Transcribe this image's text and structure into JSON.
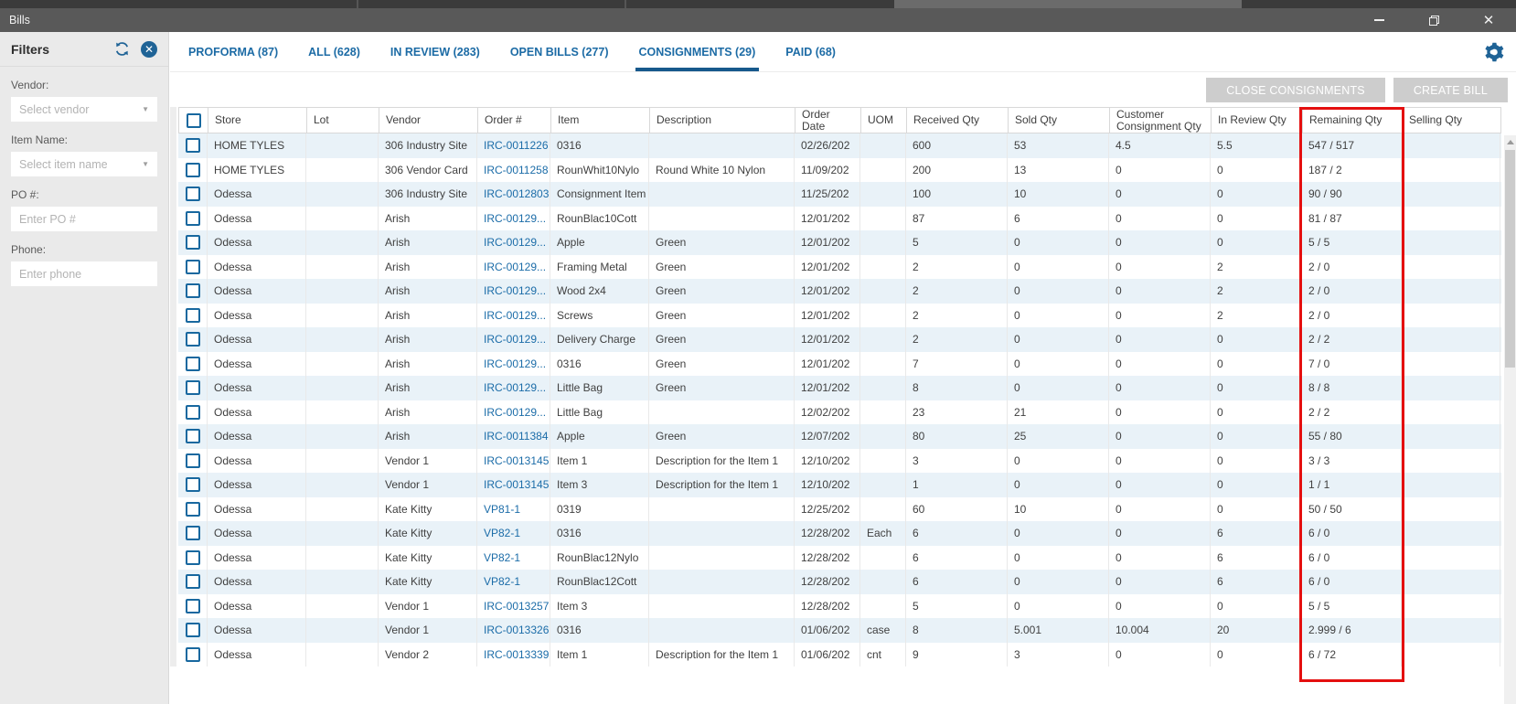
{
  "window": {
    "title": "Bills"
  },
  "icons": {
    "refresh": "circular-arrows",
    "clear_filters": "x-in-circle",
    "settings": "gear",
    "dropdown_caret": "▼",
    "window_minimize": "—",
    "window_restore": "❐",
    "window_close": "×",
    "scroll_up_arrow": "▲"
  },
  "colors": {
    "title_bar": "#595959",
    "accent_blue": "#1c6ba5",
    "link_blue": "#1b6ca8",
    "highlight_red": "#e40f0f",
    "row_alternate": "#e9f2f8",
    "button_gray": "#cdcdcd",
    "sidebar_gray": "#eaeaea"
  },
  "sidebar": {
    "title": "Filters",
    "fields": [
      {
        "label": "Vendor:",
        "placeholder": "Select vendor",
        "type": "select"
      },
      {
        "label": "Item Name:",
        "placeholder": "Select item name",
        "type": "select"
      },
      {
        "label": "PO #:",
        "placeholder": "Enter PO #",
        "type": "text"
      },
      {
        "label": "Phone:",
        "placeholder": "Enter phone",
        "type": "text"
      }
    ]
  },
  "tabs": [
    {
      "label": "PROFORMA (87)",
      "active": false
    },
    {
      "label": "ALL (628)",
      "active": false
    },
    {
      "label": "IN REVIEW (283)",
      "active": false
    },
    {
      "label": "OPEN BILLS (277)",
      "active": false
    },
    {
      "label": "CONSIGNMENTS (29)",
      "active": true
    },
    {
      "label": "PAID (68)",
      "active": false
    }
  ],
  "actions": {
    "close_consignments": "CLOSE CONSIGNMENTS",
    "create_bill": "CREATE BILL"
  },
  "table": {
    "columns": [
      "Store",
      "Lot",
      "Vendor",
      "Order #",
      "Item",
      "Description",
      "Order Date",
      "UOM",
      "Received Qty",
      "Sold Qty",
      "Customer Consignment Qty",
      "In Review Qty",
      "Remaining Qty",
      "Selling Qty"
    ],
    "highlighted_column": "Remaining Qty",
    "rows": [
      [
        "HOME TYLES",
        "",
        "306 Industry Site",
        "IRC-0011226",
        "0316",
        "",
        "02/26/202",
        "",
        "600",
        "53",
        "4.5",
        "5.5",
        "547 / 517",
        ""
      ],
      [
        "HOME TYLES",
        "",
        "306 Vendor Card",
        "IRC-0011258",
        "RounWhit10Nylo",
        "Round White 10 Nylon",
        "11/09/202",
        "",
        "200",
        "13",
        "0",
        "0",
        "187 / 2",
        ""
      ],
      [
        "Odessa",
        "",
        "306 Industry Site",
        "IRC-0012803",
        "Consignment Item",
        "",
        "11/25/202",
        "",
        "100",
        "10",
        "0",
        "0",
        "90 / 90",
        ""
      ],
      [
        "Odessa",
        "",
        "Arish",
        "IRC-00129...",
        "RounBlac10Cott",
        "",
        "12/01/202",
        "",
        "87",
        "6",
        "0",
        "0",
        "81 / 87",
        ""
      ],
      [
        "Odessa",
        "",
        "Arish",
        "IRC-00129...",
        "Apple",
        "Green",
        "12/01/202",
        "",
        "5",
        "0",
        "0",
        "0",
        "5 / 5",
        ""
      ],
      [
        "Odessa",
        "",
        "Arish",
        "IRC-00129...",
        "Framing Metal",
        "Green",
        "12/01/202",
        "",
        "2",
        "0",
        "0",
        "2",
        "2 / 0",
        ""
      ],
      [
        "Odessa",
        "",
        "Arish",
        "IRC-00129...",
        "Wood 2x4",
        "Green",
        "12/01/202",
        "",
        "2",
        "0",
        "0",
        "2",
        "2 / 0",
        ""
      ],
      [
        "Odessa",
        "",
        "Arish",
        "IRC-00129...",
        "Screws",
        "Green",
        "12/01/202",
        "",
        "2",
        "0",
        "0",
        "2",
        "2 / 0",
        ""
      ],
      [
        "Odessa",
        "",
        "Arish",
        "IRC-00129...",
        "Delivery Charge",
        "Green",
        "12/01/202",
        "",
        "2",
        "0",
        "0",
        "0",
        "2 / 2",
        ""
      ],
      [
        "Odessa",
        "",
        "Arish",
        "IRC-00129...",
        "0316",
        "Green",
        "12/01/202",
        "",
        "7",
        "0",
        "0",
        "0",
        "7 / 0",
        ""
      ],
      [
        "Odessa",
        "",
        "Arish",
        "IRC-00129...",
        "Little Bag",
        "Green",
        "12/01/202",
        "",
        "8",
        "0",
        "0",
        "0",
        "8 / 8",
        ""
      ],
      [
        "Odessa",
        "",
        "Arish",
        "IRC-00129...",
        "Little Bag",
        "",
        "12/02/202",
        "",
        "23",
        "21",
        "0",
        "0",
        "2 / 2",
        ""
      ],
      [
        "Odessa",
        "",
        "Arish",
        "IRC-0011384",
        "Apple",
        "Green",
        "12/07/202",
        "",
        "80",
        "25",
        "0",
        "0",
        "55 / 80",
        ""
      ],
      [
        "Odessa",
        "",
        "Vendor 1",
        "IRC-0013145",
        "Item 1",
        "Description for the Item 1",
        "12/10/202",
        "",
        "3",
        "0",
        "0",
        "0",
        "3 / 3",
        ""
      ],
      [
        "Odessa",
        "",
        "Vendor 1",
        "IRC-0013145",
        "Item 3",
        "Description for the Item 1",
        "12/10/202",
        "",
        "1",
        "0",
        "0",
        "0",
        "1 / 1",
        ""
      ],
      [
        "Odessa",
        "",
        "Kate Kitty",
        "VP81-1",
        "0319",
        "",
        "12/25/202",
        "",
        "60",
        "10",
        "0",
        "0",
        "50 / 50",
        ""
      ],
      [
        "Odessa",
        "",
        "Kate Kitty",
        "VP82-1",
        "0316",
        "",
        "12/28/202",
        "Each",
        "6",
        "0",
        "0",
        "6",
        "6 / 0",
        ""
      ],
      [
        "Odessa",
        "",
        "Kate Kitty",
        "VP82-1",
        "RounBlac12Nylo",
        "",
        "12/28/202",
        "",
        "6",
        "0",
        "0",
        "6",
        "6 / 0",
        ""
      ],
      [
        "Odessa",
        "",
        "Kate Kitty",
        "VP82-1",
        "RounBlac12Cott",
        "",
        "12/28/202",
        "",
        "6",
        "0",
        "0",
        "6",
        "6 / 0",
        ""
      ],
      [
        "Odessa",
        "",
        "Vendor 1",
        "IRC-0013257",
        "Item 3",
        "",
        "12/28/202",
        "",
        "5",
        "0",
        "0",
        "0",
        "5 / 5",
        ""
      ],
      [
        "Odessa",
        "",
        "Vendor 1",
        "IRC-0013326",
        "0316",
        "",
        "01/06/202",
        "case",
        "8",
        "5.001",
        "10.004",
        "20",
        "2.999 / 6",
        ""
      ],
      [
        "Odessa",
        "",
        "Vendor 2",
        "IRC-0013339",
        "Item 1",
        "Description for the Item 1",
        "01/06/202",
        "cnt",
        "9",
        "3",
        "0",
        "0",
        "6 / 72",
        ""
      ]
    ]
  }
}
